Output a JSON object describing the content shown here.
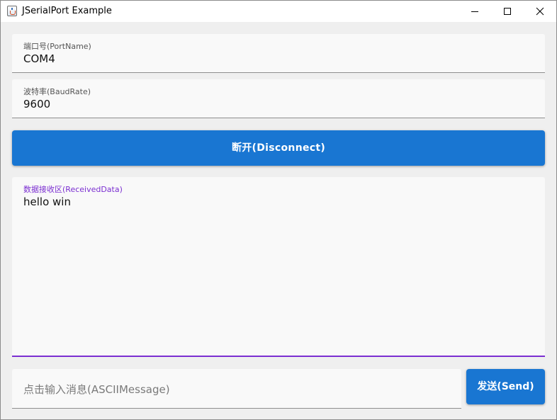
{
  "window": {
    "title": "JSerialPort Example"
  },
  "port": {
    "label": "端口号(PortName)",
    "value": "COM4"
  },
  "baud": {
    "label": "波特率(BaudRate)",
    "value": "9600"
  },
  "connect_button": {
    "label": "断开(Disconnect)"
  },
  "received": {
    "label": "数据接收区(ReceivedData)",
    "value": "hello win"
  },
  "message": {
    "placeholder": "点击输入消息(ASCIIMessage)"
  },
  "send_button": {
    "label": "发送(Send)"
  },
  "colors": {
    "accent": "#1976d2",
    "focus": "#7b2fd1"
  },
  "icons": {
    "app": "java-app-icon",
    "minimize": "minimize-icon",
    "maximize": "maximize-icon",
    "close": "close-icon"
  }
}
